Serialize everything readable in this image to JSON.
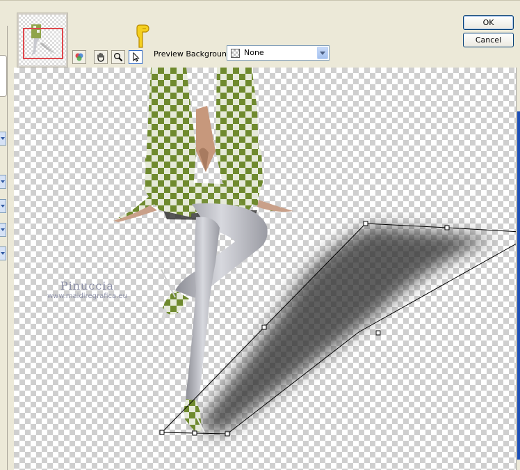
{
  "dialog": {
    "ok_label": "OK",
    "cancel_label": "Cancel"
  },
  "toolbar": {
    "tools": [
      {
        "name": "proof-tool",
        "icon": "paint-icon"
      },
      {
        "name": "pan-tool",
        "icon": "hand-icon"
      },
      {
        "name": "zoom-tool",
        "icon": "magnifier-icon"
      },
      {
        "name": "pointer-tool",
        "icon": "arrow-cursor-icon",
        "active": true
      }
    ],
    "preview_background_label": "Preview Background:",
    "preview_background_value": "None"
  },
  "canvas": {
    "watermark_name": "Pinuccia",
    "watermark_url": "www.maidiregrafica.eu"
  },
  "colors": {
    "accent": "#316ac5",
    "thumbnail_frame": "#e0474c",
    "pointer_hand": "#f5d020",
    "dialog_bg": "#ece9d8"
  }
}
